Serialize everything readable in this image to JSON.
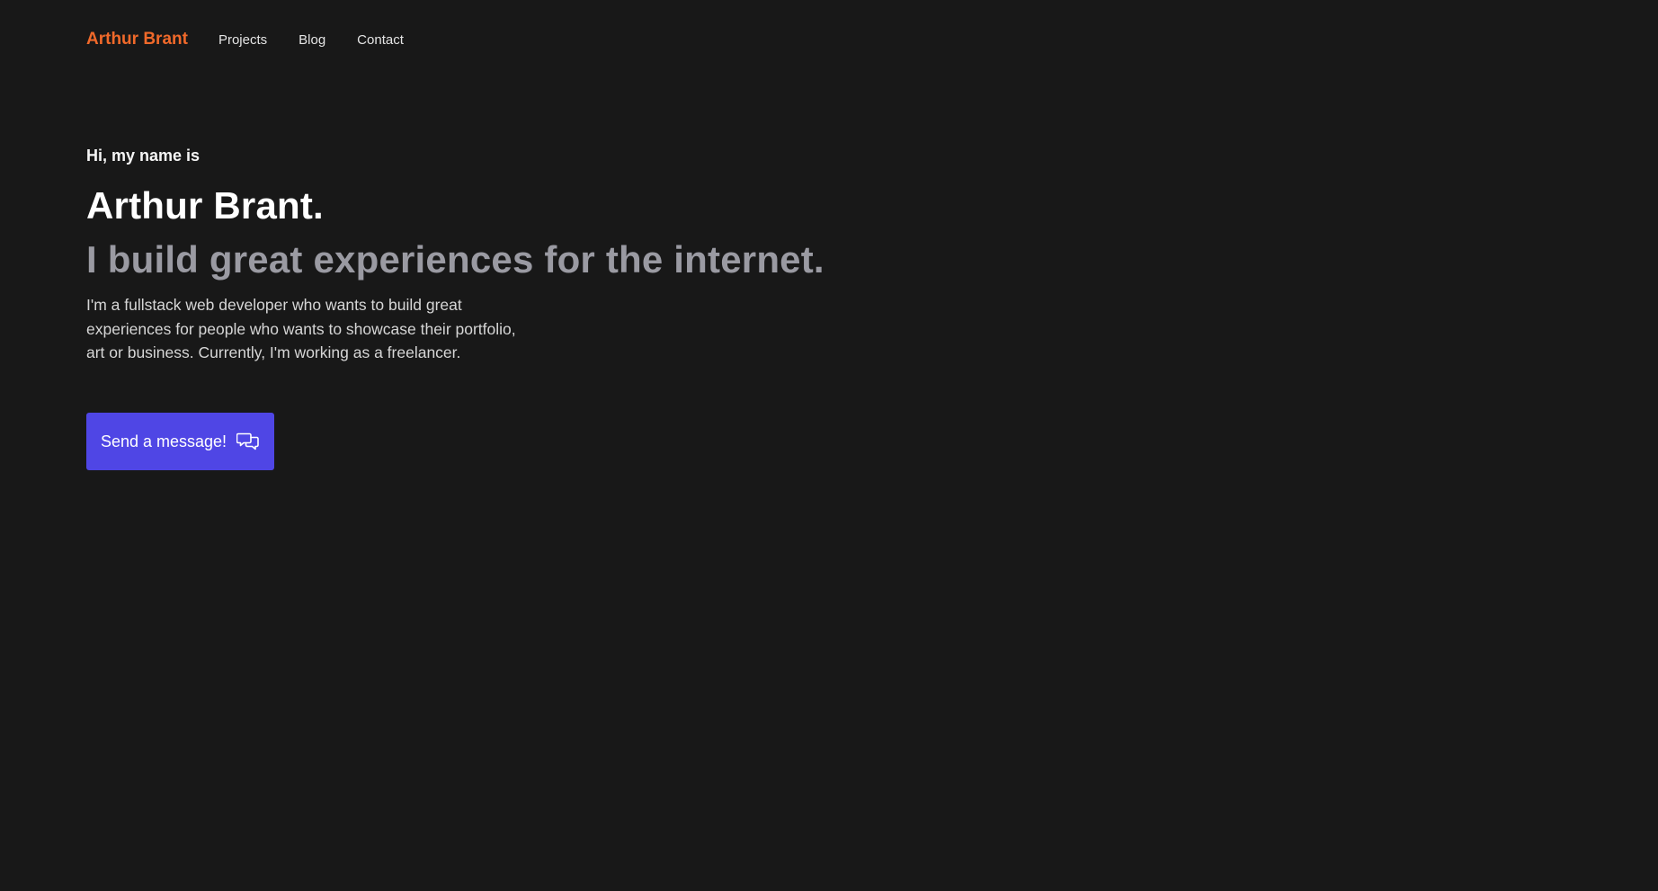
{
  "nav": {
    "brand": "Arthur Brant",
    "links": [
      {
        "label": "Projects"
      },
      {
        "label": "Blog"
      },
      {
        "label": "Contact"
      }
    ]
  },
  "hero": {
    "greeting": "Hi, my name is",
    "name": "Arthur Brant.",
    "tagline": "I build great experiences for the internet.",
    "bio": "I'm a fullstack web developer who wants to build great experiences for people who wants to showcase their portfolio, art or business. Currently, I'm working as a freelancer.",
    "cta_label": "Send a message!",
    "cta_icon": "chat-bubbles-icon"
  },
  "colors": {
    "background": "#181818",
    "brand": "#f0692a",
    "accent": "#4f46e5",
    "tagline": "#9a9aa2"
  }
}
